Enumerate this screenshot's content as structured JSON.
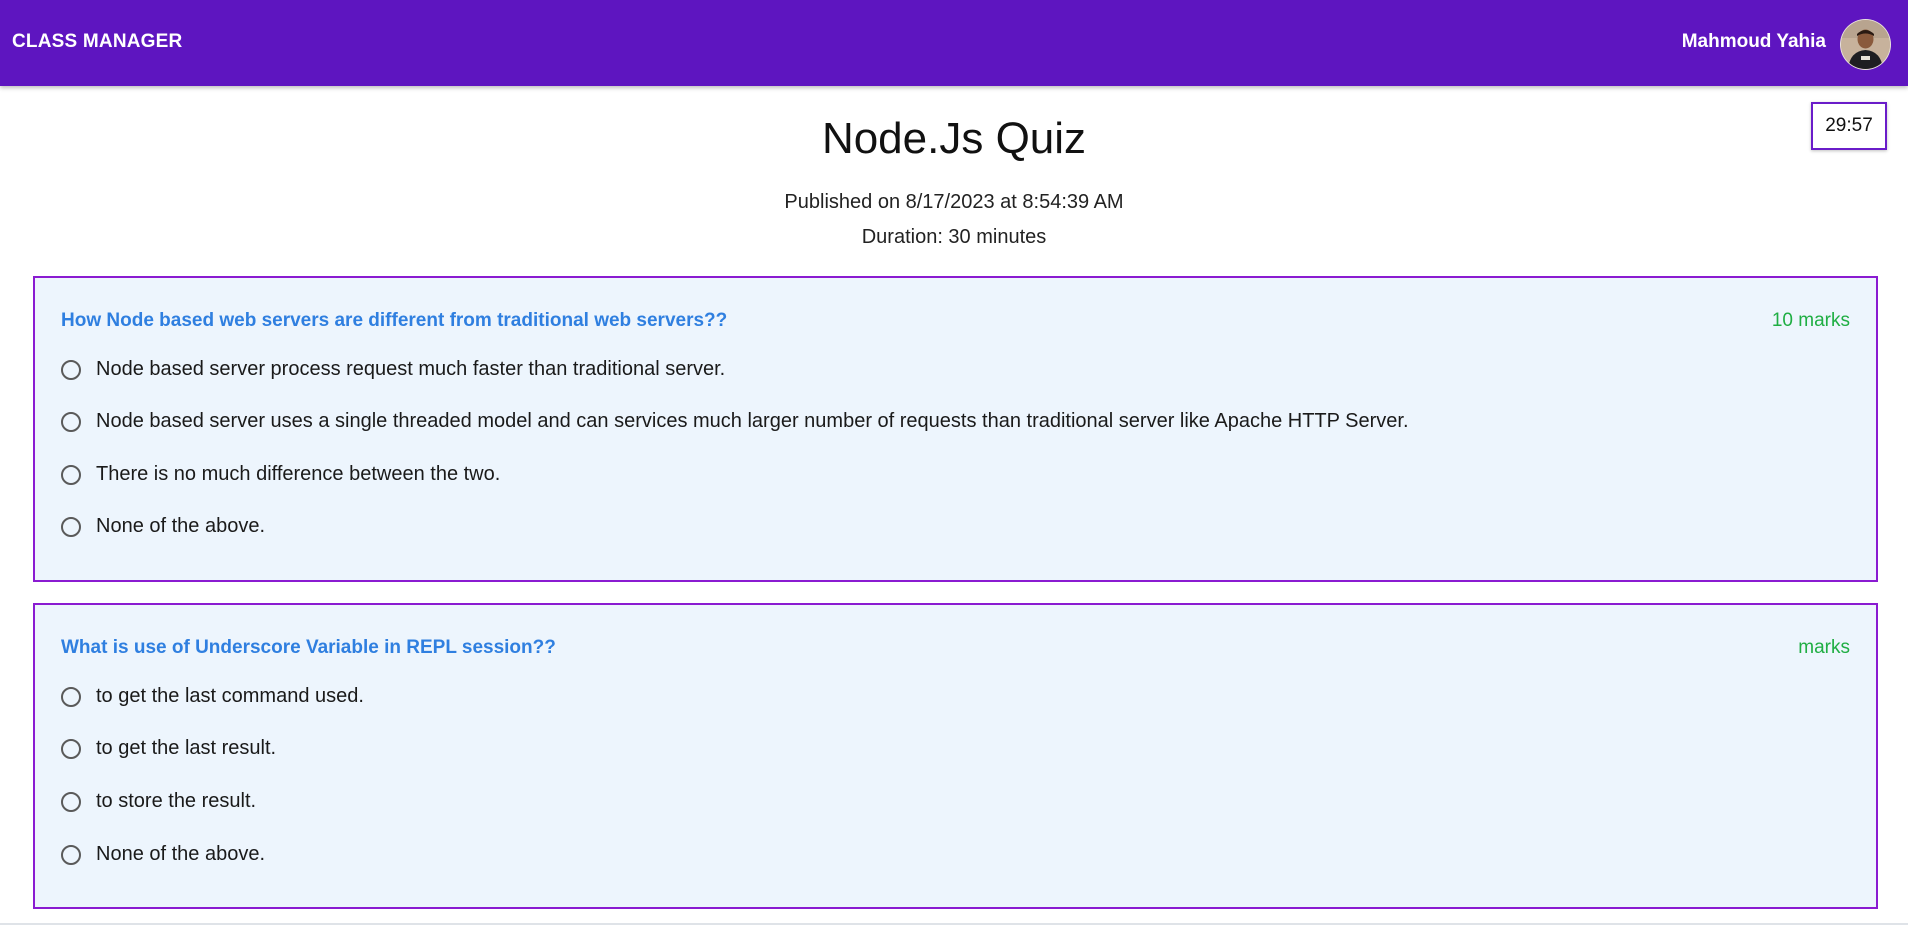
{
  "header": {
    "brand": "CLASS MANAGER",
    "user_name": "Mahmoud Yahia",
    "brand_color": "#5e15c0"
  },
  "timer": {
    "value": "29:57"
  },
  "quiz": {
    "title": "Node.Js Quiz",
    "published": "Published on 8/17/2023 at 8:54:39 AM",
    "duration": "Duration: 30 minutes"
  },
  "questions": [
    {
      "text": "How Node based web servers are different from traditional web servers??",
      "marks": "10 marks",
      "options": [
        "Node based server process request much faster than traditional server.",
        "Node based server uses a single threaded model and can services much larger number of requests than traditional server like Apache HTTP Server.",
        "There is no much difference between the two.",
        "None of the above."
      ]
    },
    {
      "text": "What is use of Underscore Variable in REPL session??",
      "marks": "marks",
      "options": [
        "to get the last command used.",
        "to get the last result.",
        "to store the result.",
        "None of the above."
      ]
    }
  ]
}
